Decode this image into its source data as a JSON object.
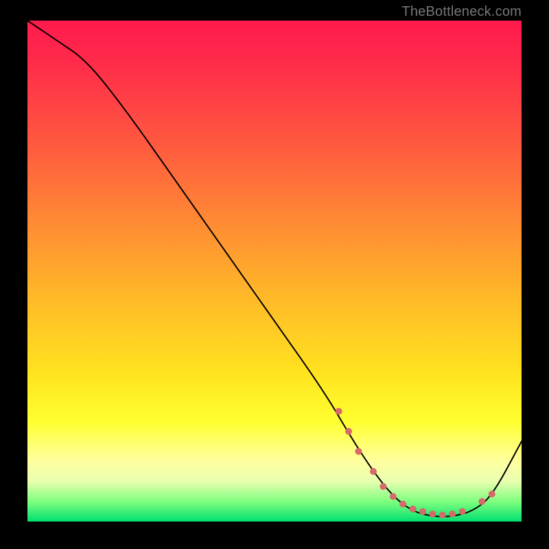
{
  "attribution": "TheBottleneck.com",
  "chart_data": {
    "type": "line",
    "title": "",
    "xlabel": "",
    "ylabel": "",
    "xlim": [
      0,
      100
    ],
    "ylim": [
      0,
      100
    ],
    "grid": false,
    "curve": {
      "name": "bottleneck-curve",
      "x": [
        0,
        6,
        12,
        20,
        30,
        40,
        50,
        60,
        66,
        70,
        74,
        78,
        82,
        86,
        90,
        94,
        100
      ],
      "y": [
        100,
        96,
        92,
        82,
        68,
        54,
        40,
        26,
        16,
        10,
        5,
        2,
        1,
        1,
        2,
        5,
        16
      ],
      "stroke": "#000000",
      "stroke_width": 2
    },
    "markers": {
      "name": "highlight-points",
      "color": "#d66a6a",
      "radius": 5,
      "points": [
        {
          "x": 63,
          "y": 22
        },
        {
          "x": 65,
          "y": 18
        },
        {
          "x": 67,
          "y": 14
        },
        {
          "x": 70,
          "y": 10
        },
        {
          "x": 72,
          "y": 7
        },
        {
          "x": 74,
          "y": 5
        },
        {
          "x": 76,
          "y": 3.5
        },
        {
          "x": 78,
          "y": 2.5
        },
        {
          "x": 80,
          "y": 2
        },
        {
          "x": 82,
          "y": 1.5
        },
        {
          "x": 84,
          "y": 1.3
        },
        {
          "x": 86,
          "y": 1.5
        },
        {
          "x": 88,
          "y": 2
        },
        {
          "x": 92,
          "y": 4
        },
        {
          "x": 94,
          "y": 5.5
        }
      ]
    }
  }
}
